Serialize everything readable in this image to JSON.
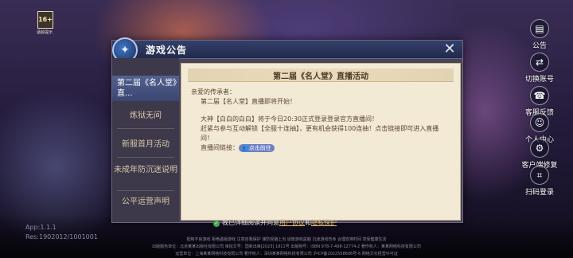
{
  "age_rating": {
    "badge": "16+",
    "caption": "适龄提示"
  },
  "version": {
    "app": "App:1.1.1",
    "res": "Res:1902012/1001001"
  },
  "side_menu": [
    {
      "icon": "announcement-icon",
      "glyph": "▤",
      "label": "公告"
    },
    {
      "icon": "switch-account-icon",
      "glyph": "⇄",
      "label": "切换账号"
    },
    {
      "icon": "customer-service-icon",
      "glyph": "☎",
      "label": "客服反馈"
    },
    {
      "icon": "user-icon",
      "glyph": "☺",
      "label": "个人中心"
    },
    {
      "icon": "repair-icon",
      "glyph": "⚙",
      "label": "客户端修复"
    },
    {
      "icon": "qr-scan-icon",
      "glyph": "⌗",
      "label": "扫码登录"
    }
  ],
  "dialog": {
    "title": "游戏公告",
    "tabs": [
      {
        "label": "第二届《名人堂》直...",
        "active": true
      },
      {
        "label": "炼狱无间",
        "active": false
      },
      {
        "label": "新服首月活动",
        "active": false
      },
      {
        "label": "未成年防沉迷说明",
        "active": false
      },
      {
        "label": "公平运营声明",
        "active": false
      }
    ],
    "content": {
      "title": "第二届《名人堂》直播活动",
      "greeting": "亲爱的传承者：",
      "line1": "第二届【名人堂】直播即将开始！",
      "line2": "大神【白白的白白】将于今日20:30正式登录登录官方直播间！",
      "line3": "赶紧与参与互动解锁【全服十连抽】，更有机会获得100连抽！点击链接即可进入直播间！",
      "link_label": "直播间链接：",
      "link_button": "点击前往"
    }
  },
  "footer": {
    "agree_prefix": "我已详细阅读并同意",
    "user_agreement": "用户协议",
    "and": "和",
    "privacy": "隐私保护",
    "legal_line1": "抵制不良游戏 拒绝盗版游戏 注意自我保护 谨防受骗上当 适度游戏益脑 沉迷游戏伤身 合理安排时间 享受健康生活",
    "legal_line2": "出版服务单位：北京某某出版社有限公司  审批文号：国新出审[2023] 1811号  出版物号：ISBN 978-7-498-12774-2  著作权人：某某网络科技有限公司",
    "legal_line3": "运营单位：上海某某网络科技有限公司  著作权人：深圳某某网络科技有限公司  沪ICP备2022558606号-6  网络文化经营许可证"
  }
}
